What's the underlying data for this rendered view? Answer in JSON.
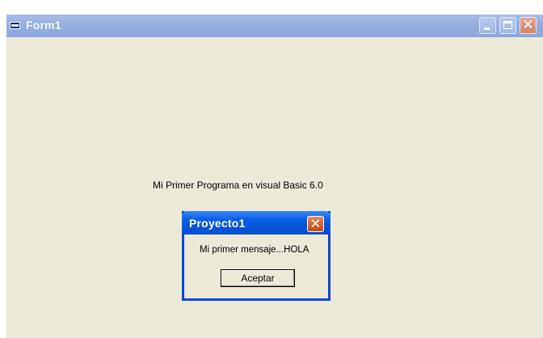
{
  "form": {
    "title": "Form1",
    "label": "Mi Primer Programa en visual Basic 6.0"
  },
  "caption_buttons": {
    "minimize_icon": "minimize-icon",
    "maximize_icon": "maximize-icon",
    "close_icon": "close-icon",
    "close_glyph": "✕"
  },
  "dialog": {
    "title": "Proyecto1",
    "message": "Mi primer mensaje...HOLA",
    "button_label": "Aceptar",
    "close_glyph": "✕"
  },
  "colors": {
    "form_background": "#ece9d8",
    "form_titlebar": "#97aee0",
    "dialog_titlebar": "#0654d8",
    "dialog_close": "#d65f32"
  }
}
